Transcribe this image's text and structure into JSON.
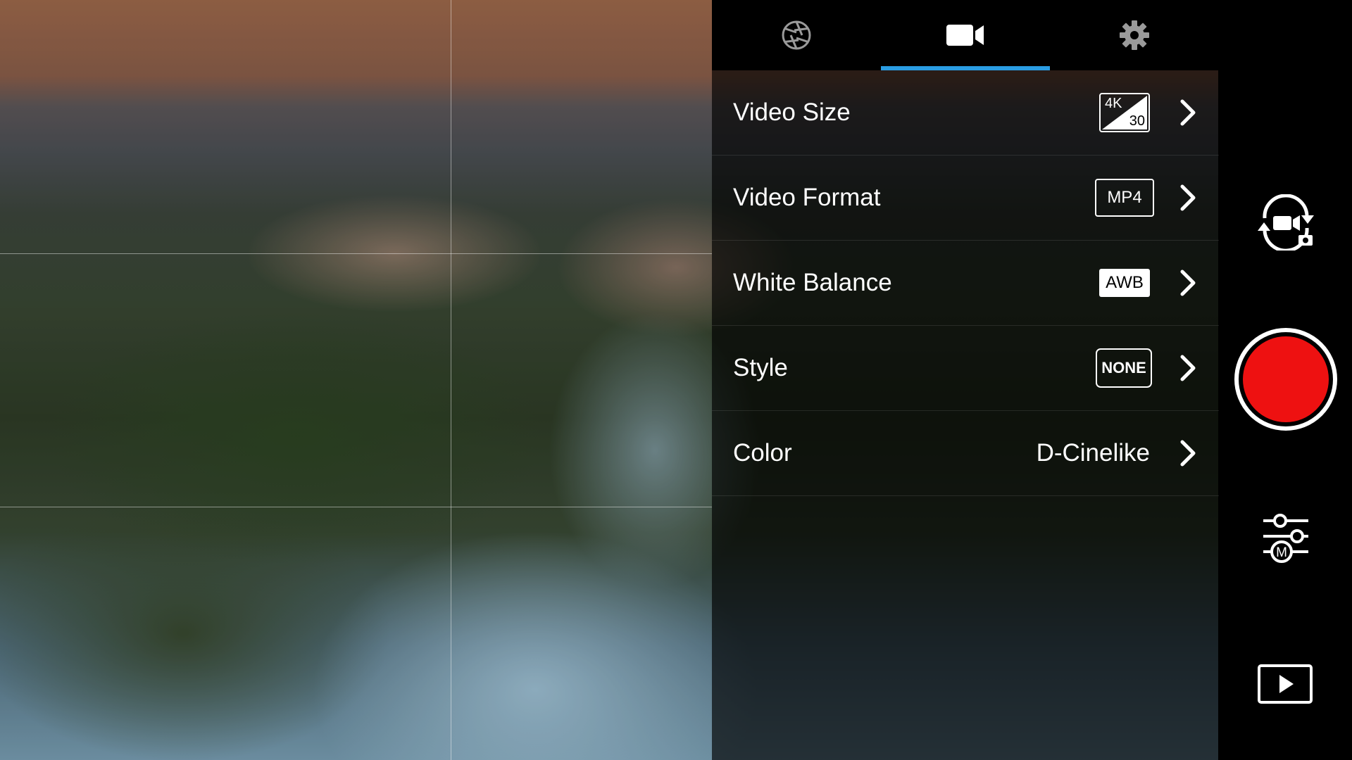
{
  "tabs": [
    {
      "name": "Photo",
      "icon": "aperture-icon",
      "selected": false
    },
    {
      "name": "Video",
      "icon": "video-camera-icon",
      "selected": true
    },
    {
      "name": "Settings",
      "icon": "gear-icon",
      "selected": false
    }
  ],
  "settings": {
    "video_size": {
      "label": "Video Size",
      "badge_top": "4K",
      "badge_bottom": "30"
    },
    "video_format": {
      "label": "Video Format",
      "badge": "MP4"
    },
    "white_balance": {
      "label": "White Balance",
      "badge": "AWB"
    },
    "style": {
      "label": "Style",
      "badge": "NONE"
    },
    "color": {
      "label": "Color",
      "value": "D-Cinelike"
    }
  },
  "controls": {
    "switch_mode_icon": "switch-camera-mode-icon",
    "record_icon": "record-button",
    "manual_settings_icon": "manual-settings-sliders-icon",
    "manual_badge": "M",
    "playback_icon": "playback-icon"
  },
  "colors": {
    "accent": "#2a9de3",
    "record": "#ee1111"
  },
  "preview": {
    "grid": "rule-of-thirds"
  }
}
